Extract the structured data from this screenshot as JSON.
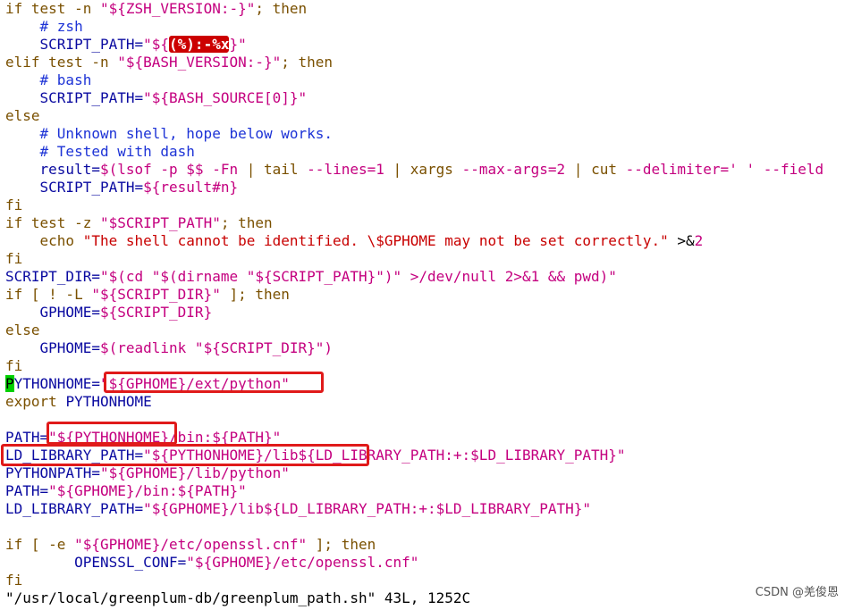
{
  "editor": {
    "lines": [
      [
        {
          "t": "if test -n ",
          "c": "kw"
        },
        {
          "t": "\"${ZSH_VERSION:-}\"",
          "c": "str"
        },
        {
          "t": "; then",
          "c": "kw"
        }
      ],
      [
        {
          "t": "    # zsh",
          "c": "com"
        }
      ],
      [
        {
          "t": "    SCRIPT_PATH=",
          "c": "id"
        },
        {
          "t": "\"${",
          "c": "str"
        },
        {
          "t": "(%):-%x",
          "c": "err"
        },
        {
          "t": "}\"",
          "c": "str"
        }
      ],
      [
        {
          "t": "elif test -n ",
          "c": "kw"
        },
        {
          "t": "\"${BASH_VERSION:-}\"",
          "c": "str"
        },
        {
          "t": "; then",
          "c": "kw"
        }
      ],
      [
        {
          "t": "    # bash",
          "c": "com"
        }
      ],
      [
        {
          "t": "    SCRIPT_PATH=",
          "c": "id"
        },
        {
          "t": "\"${BASH_SOURCE[0]}\"",
          "c": "str"
        }
      ],
      [
        {
          "t": "else",
          "c": "kw"
        }
      ],
      [
        {
          "t": "    # Unknown shell, hope below works.",
          "c": "com"
        }
      ],
      [
        {
          "t": "    # Tested with dash",
          "c": "com"
        }
      ],
      [
        {
          "t": "    result=",
          "c": "id"
        },
        {
          "t": "$(lsof -p $$ -Fn ",
          "c": "var"
        },
        {
          "t": "| ",
          "c": "kw"
        },
        {
          "t": "tail ",
          "c": "kw"
        },
        {
          "t": "--lines=1 ",
          "c": "str"
        },
        {
          "t": "| ",
          "c": "kw"
        },
        {
          "t": "xargs ",
          "c": "kw"
        },
        {
          "t": "--max-args=2 ",
          "c": "str"
        },
        {
          "t": "| ",
          "c": "kw"
        },
        {
          "t": "cut ",
          "c": "kw"
        },
        {
          "t": "--delimiter=' ' --field",
          "c": "str"
        }
      ],
      [
        {
          "t": "    SCRIPT_PATH=",
          "c": "id"
        },
        {
          "t": "${result#n}",
          "c": "var"
        }
      ],
      [
        {
          "t": "fi",
          "c": "kw"
        }
      ],
      [
        {
          "t": "if test -z ",
          "c": "kw"
        },
        {
          "t": "\"$SCRIPT_PATH\"",
          "c": "str"
        },
        {
          "t": "; then",
          "c": "kw"
        }
      ],
      [
        {
          "t": "    echo ",
          "c": "kw"
        },
        {
          "t": "\"The shell cannot be identified. \\$GPHOME may not be set correctly.\"",
          "c": "strred"
        },
        {
          "t": " >&",
          "c": "txt"
        },
        {
          "t": "2",
          "c": "str"
        }
      ],
      [
        {
          "t": "fi",
          "c": "kw"
        }
      ],
      [
        {
          "t": "SCRIPT_DIR=",
          "c": "id"
        },
        {
          "t": "\"$(cd \"$(dirname \"${SCRIPT_PATH}\")\" >/dev/null 2>&1 && pwd)\"",
          "c": "str"
        }
      ],
      [
        {
          "t": "if [ ! -L ",
          "c": "kw"
        },
        {
          "t": "\"${SCRIPT_DIR}\"",
          "c": "str"
        },
        {
          "t": " ]; then",
          "c": "kw"
        }
      ],
      [
        {
          "t": "    GPHOME=",
          "c": "id"
        },
        {
          "t": "${SCRIPT_DIR}",
          "c": "var"
        }
      ],
      [
        {
          "t": "else",
          "c": "kw"
        }
      ],
      [
        {
          "t": "    GPHOME=",
          "c": "id"
        },
        {
          "t": "$(readlink \"${SCRIPT_DIR}\")",
          "c": "var"
        }
      ],
      [
        {
          "t": "fi",
          "c": "kw"
        }
      ],
      [
        {
          "t": "P",
          "c": "cursor"
        },
        {
          "t": "YTHONHOME=",
          "c": "id"
        },
        {
          "t": "\"${GPHOME}/ext/python\"",
          "c": "str"
        }
      ],
      [
        {
          "t": "export ",
          "c": "kw"
        },
        {
          "t": "PYTHONHOME",
          "c": "id"
        }
      ],
      [
        {
          "t": "",
          "c": "txt"
        }
      ],
      [
        {
          "t": "PATH=",
          "c": "id"
        },
        {
          "t": "\"${PYTHONHOME}/bin:${PATH}\"",
          "c": "str"
        }
      ],
      [
        {
          "t": "LD_LIBRARY_PATH=",
          "c": "id"
        },
        {
          "t": "\"${PYTHONHOME}/lib${LD_LIBRARY_PATH:+:$LD_LIBRARY_PATH}\"",
          "c": "str"
        }
      ],
      [
        {
          "t": "PYTHONPATH=",
          "c": "id"
        },
        {
          "t": "\"${GPHOME}/lib/python\"",
          "c": "str"
        }
      ],
      [
        {
          "t": "PATH=",
          "c": "id"
        },
        {
          "t": "\"${GPHOME}/bin:${PATH}\"",
          "c": "str"
        }
      ],
      [
        {
          "t": "LD_LIBRARY_PATH=",
          "c": "id"
        },
        {
          "t": "\"${GPHOME}/lib${LD_LIBRARY_PATH:+:$LD_LIBRARY_PATH}\"",
          "c": "str"
        }
      ],
      [
        {
          "t": "",
          "c": "txt"
        }
      ],
      [
        {
          "t": "if [ -e ",
          "c": "kw"
        },
        {
          "t": "\"${GPHOME}/etc/openssl.cnf\"",
          "c": "str"
        },
        {
          "t": " ]; then",
          "c": "kw"
        }
      ],
      [
        {
          "t": "        OPENSSL_CONF=",
          "c": "id"
        },
        {
          "t": "\"${GPHOME}/etc/openssl.cnf\"",
          "c": "str"
        }
      ],
      [
        {
          "t": "fi",
          "c": "kw"
        }
      ]
    ]
  },
  "status_line": "\"/usr/local/greenplum-db/greenplum_path.sh\" 43L, 1252C",
  "watermark": "CSDN @羌俊恩",
  "colors": {
    "keyword": "#7a5000",
    "string": "#c4007f",
    "comment": "#1d33d6",
    "identifier": "#0a0aa0",
    "error_bg": "#cc0000",
    "cursor_bg": "#00d000",
    "highlight_box": "#e01a1a"
  }
}
